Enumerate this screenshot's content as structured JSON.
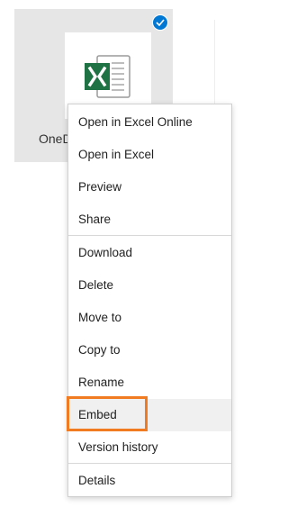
{
  "file_tile": {
    "name": "OneDrive",
    "icon": "excel-file-icon",
    "selected": true,
    "check_color": "#0078d4",
    "shared_icon": "people-icon"
  },
  "context_menu": {
    "groups": [
      [
        "Open in Excel Online",
        "Open in Excel",
        "Preview",
        "Share"
      ],
      [
        "Download",
        "Delete",
        "Move to",
        "Copy to",
        "Rename",
        "Embed",
        "Version history"
      ],
      [
        "Details"
      ]
    ],
    "highlighted_item": "Embed",
    "highlight_color": "#f07b21"
  }
}
